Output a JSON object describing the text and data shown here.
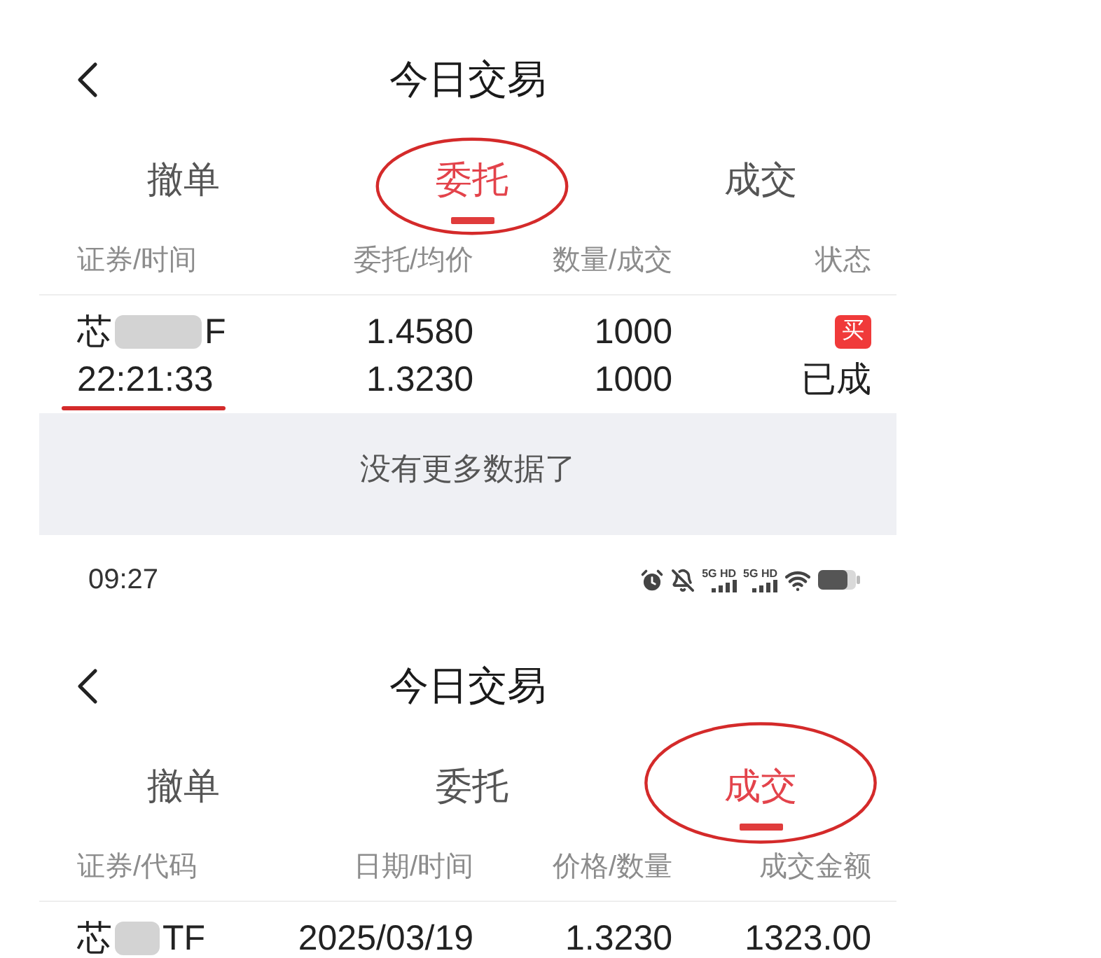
{
  "screens": [
    {
      "header": {
        "title": "今日交易"
      },
      "tabs": [
        {
          "label": "撤单",
          "selected": false,
          "circled": false
        },
        {
          "label": "委托",
          "selected": true,
          "circled": true
        },
        {
          "label": "成交",
          "selected": false,
          "circled": false
        }
      ],
      "table": {
        "columns": [
          "证券/时间",
          "委托/均价",
          "数量/成交",
          "状态"
        ],
        "rows": [
          {
            "cells": [
              [
                {
                  "kind": "masked_name",
                  "start": "芯",
                  "end": "F"
                },
                {
                  "kind": "text",
                  "text": "22:21:33",
                  "underlined": true
                }
              ],
              [
                {
                  "kind": "text",
                  "text": "1.4580"
                },
                {
                  "kind": "text",
                  "text": "1.3230"
                }
              ],
              [
                {
                  "kind": "text",
                  "text": "1000"
                },
                {
                  "kind": "text",
                  "text": "1000"
                }
              ],
              [
                {
                  "kind": "badge",
                  "text": "买"
                },
                {
                  "kind": "text",
                  "text": "已成"
                }
              ]
            ]
          }
        ]
      },
      "footer": "没有更多数据了"
    },
    {
      "status_bar": {
        "time": "09:27",
        "networks": [
          {
            "label": "5G HD"
          },
          {
            "label": "5G HD"
          }
        ]
      },
      "header": {
        "title": "今日交易"
      },
      "tabs": [
        {
          "label": "撤单",
          "selected": false,
          "circled": false
        },
        {
          "label": "委托",
          "selected": false,
          "circled": false
        },
        {
          "label": "成交",
          "selected": true,
          "circled": true
        }
      ],
      "table": {
        "columns": [
          "证券/代码",
          "日期/时间",
          "价格/数量",
          "成交金额"
        ],
        "rows": [
          {
            "cells": [
              [
                {
                  "kind": "masked_name",
                  "start": "芯",
                  "end": "TF"
                }
              ],
              [
                {
                  "kind": "text",
                  "text": "2025/03/19"
                }
              ],
              [
                {
                  "kind": "text",
                  "text": "1.3230"
                }
              ],
              [
                {
                  "kind": "text",
                  "text": "1323.00"
                }
              ]
            ]
          }
        ]
      }
    }
  ]
}
